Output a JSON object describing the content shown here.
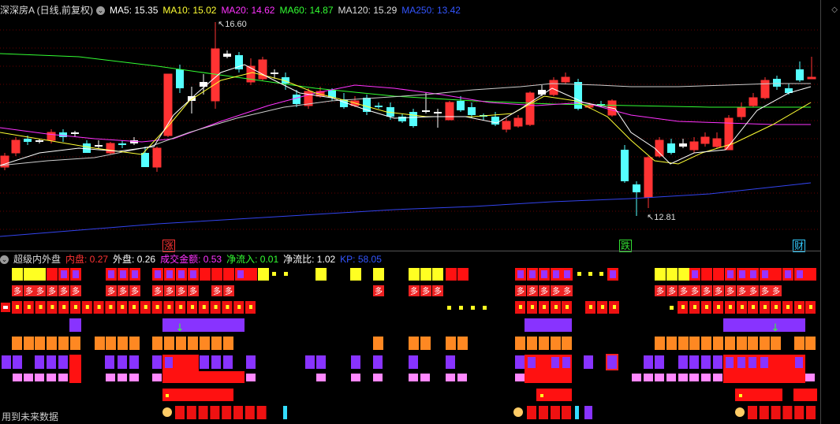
{
  "header": {
    "title": "深深房A (日线,前复权)",
    "ma": [
      {
        "label": "MA5: 15.35",
        "color": "#ffffff"
      },
      {
        "label": "MA10: 15.02",
        "color": "#ffff33"
      },
      {
        "label": "MA20: 14.62",
        "color": "#ff33ff"
      },
      {
        "label": "MA60: 14.87",
        "color": "#33ff33"
      },
      {
        "label": "MA120: 15.29",
        "color": "#dddddd"
      },
      {
        "label": "MA250: 13.42",
        "color": "#3355ff"
      }
    ]
  },
  "main_chart": {
    "high_label": "16.60",
    "low_label": "12.81",
    "flags": [
      {
        "text": "涨",
        "color": "#ff3333"
      },
      {
        "text": "跌",
        "color": "#33dd33"
      },
      {
        "text": "财",
        "color": "#33ccff"
      }
    ]
  },
  "indicator": {
    "title": "超级内外盘",
    "values": [
      {
        "label": "内盘: 0.27",
        "color": "#ff3333"
      },
      {
        "label": "外盘: 0.26",
        "color": "#ffffff"
      },
      {
        "label": "成交金额: 0.53",
        "color": "#ff33ff"
      },
      {
        "label": "净流入: 0.01",
        "color": "#33ff33"
      },
      {
        "label": "净流比: 1.02",
        "color": "#ffffff"
      },
      {
        "label": "KP: 58.05",
        "color": "#3355ff"
      }
    ],
    "duo_char": "多"
  },
  "footer": {
    "text": "用到未来数据"
  }
}
